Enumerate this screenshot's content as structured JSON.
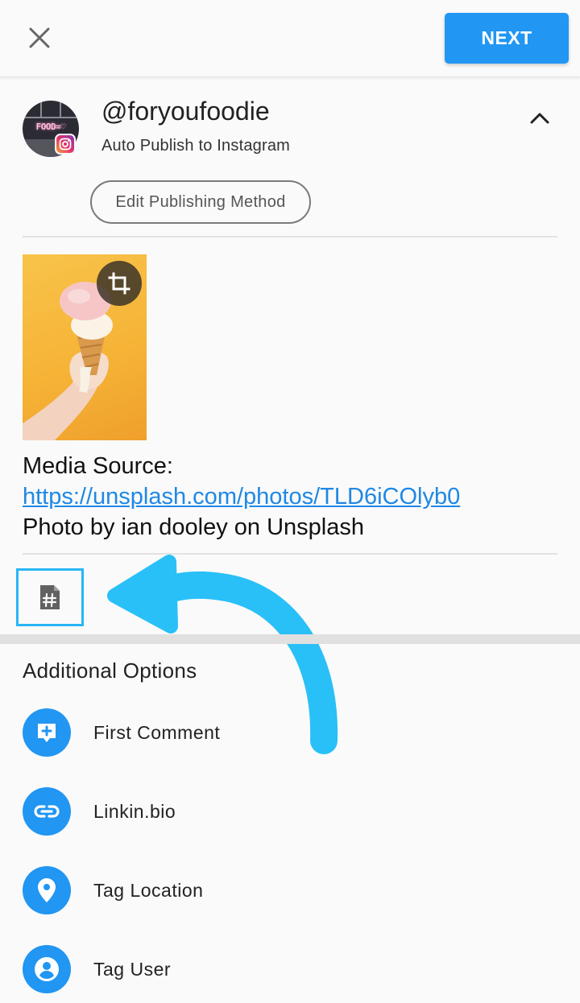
{
  "header": {
    "close_icon": "close-icon",
    "next_label": "NEXT"
  },
  "account": {
    "avatar_text": "FOOD=♡",
    "username": "@foryoufoodie",
    "publish_mode": "Auto Publish to Instagram",
    "edit_method_label": "Edit Publishing Method"
  },
  "post": {
    "media_icon": "crop-icon",
    "caption": {
      "line1": "Media Source:",
      "link": "https://unsplash.com/photos/TLD6iCOlyb0",
      "line3": "Photo by ian dooley on Unsplash"
    },
    "hashtag_icon": "hashtag-document-icon"
  },
  "additional_options": {
    "title": "Additional Options",
    "items": [
      {
        "label": "First Comment",
        "icon": "add-comment-icon"
      },
      {
        "label": "Linkin.bio",
        "icon": "link-icon"
      },
      {
        "label": "Tag Location",
        "icon": "location-pin-icon"
      },
      {
        "label": "Tag User",
        "icon": "account-circle-icon"
      }
    ]
  },
  "colors": {
    "accent": "#2196f3",
    "highlight": "#29b6f6"
  }
}
